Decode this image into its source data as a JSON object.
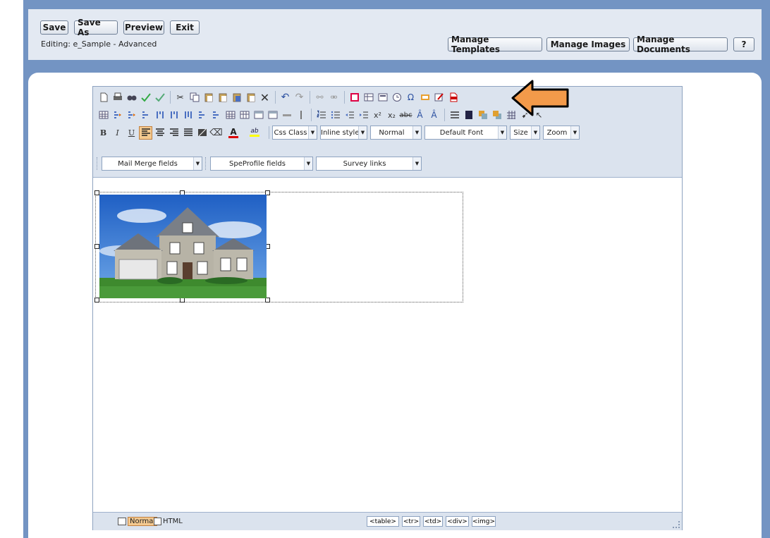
{
  "toolbar": {
    "save": "Save",
    "save_as": "Save As",
    "preview": "Preview",
    "exit": "Exit",
    "editing_text": "Editing: e_Sample - Advanced",
    "manage_templates": "Manage Templates",
    "manage_images": "Manage Images",
    "manage_documents": "Manage Documents",
    "help": "?"
  },
  "format_row": {
    "bold": "B",
    "italic": "I",
    "underline": "U",
    "font_color_glyph": "A",
    "highlight_glyph": "ab",
    "dropdowns": {
      "css_class": "Css Class",
      "inline_style": "Inline style",
      "paragraph": "Normal",
      "font": "Default Font",
      "size": "Size",
      "zoom": "Zoom"
    }
  },
  "fields_row": {
    "mail_merge": "Mail Merge fields",
    "speprofile": "SpeProfile fields",
    "survey_links": "Survey links"
  },
  "status": {
    "normal": "Normal",
    "html": "HTML",
    "tags": [
      "<table>",
      "<tr>",
      "<td>",
      "<div>",
      "<img>"
    ]
  },
  "colors": {
    "frame": "#7394c3",
    "toolbar": "#dbe3ee",
    "arrow": "#f39a4a"
  }
}
